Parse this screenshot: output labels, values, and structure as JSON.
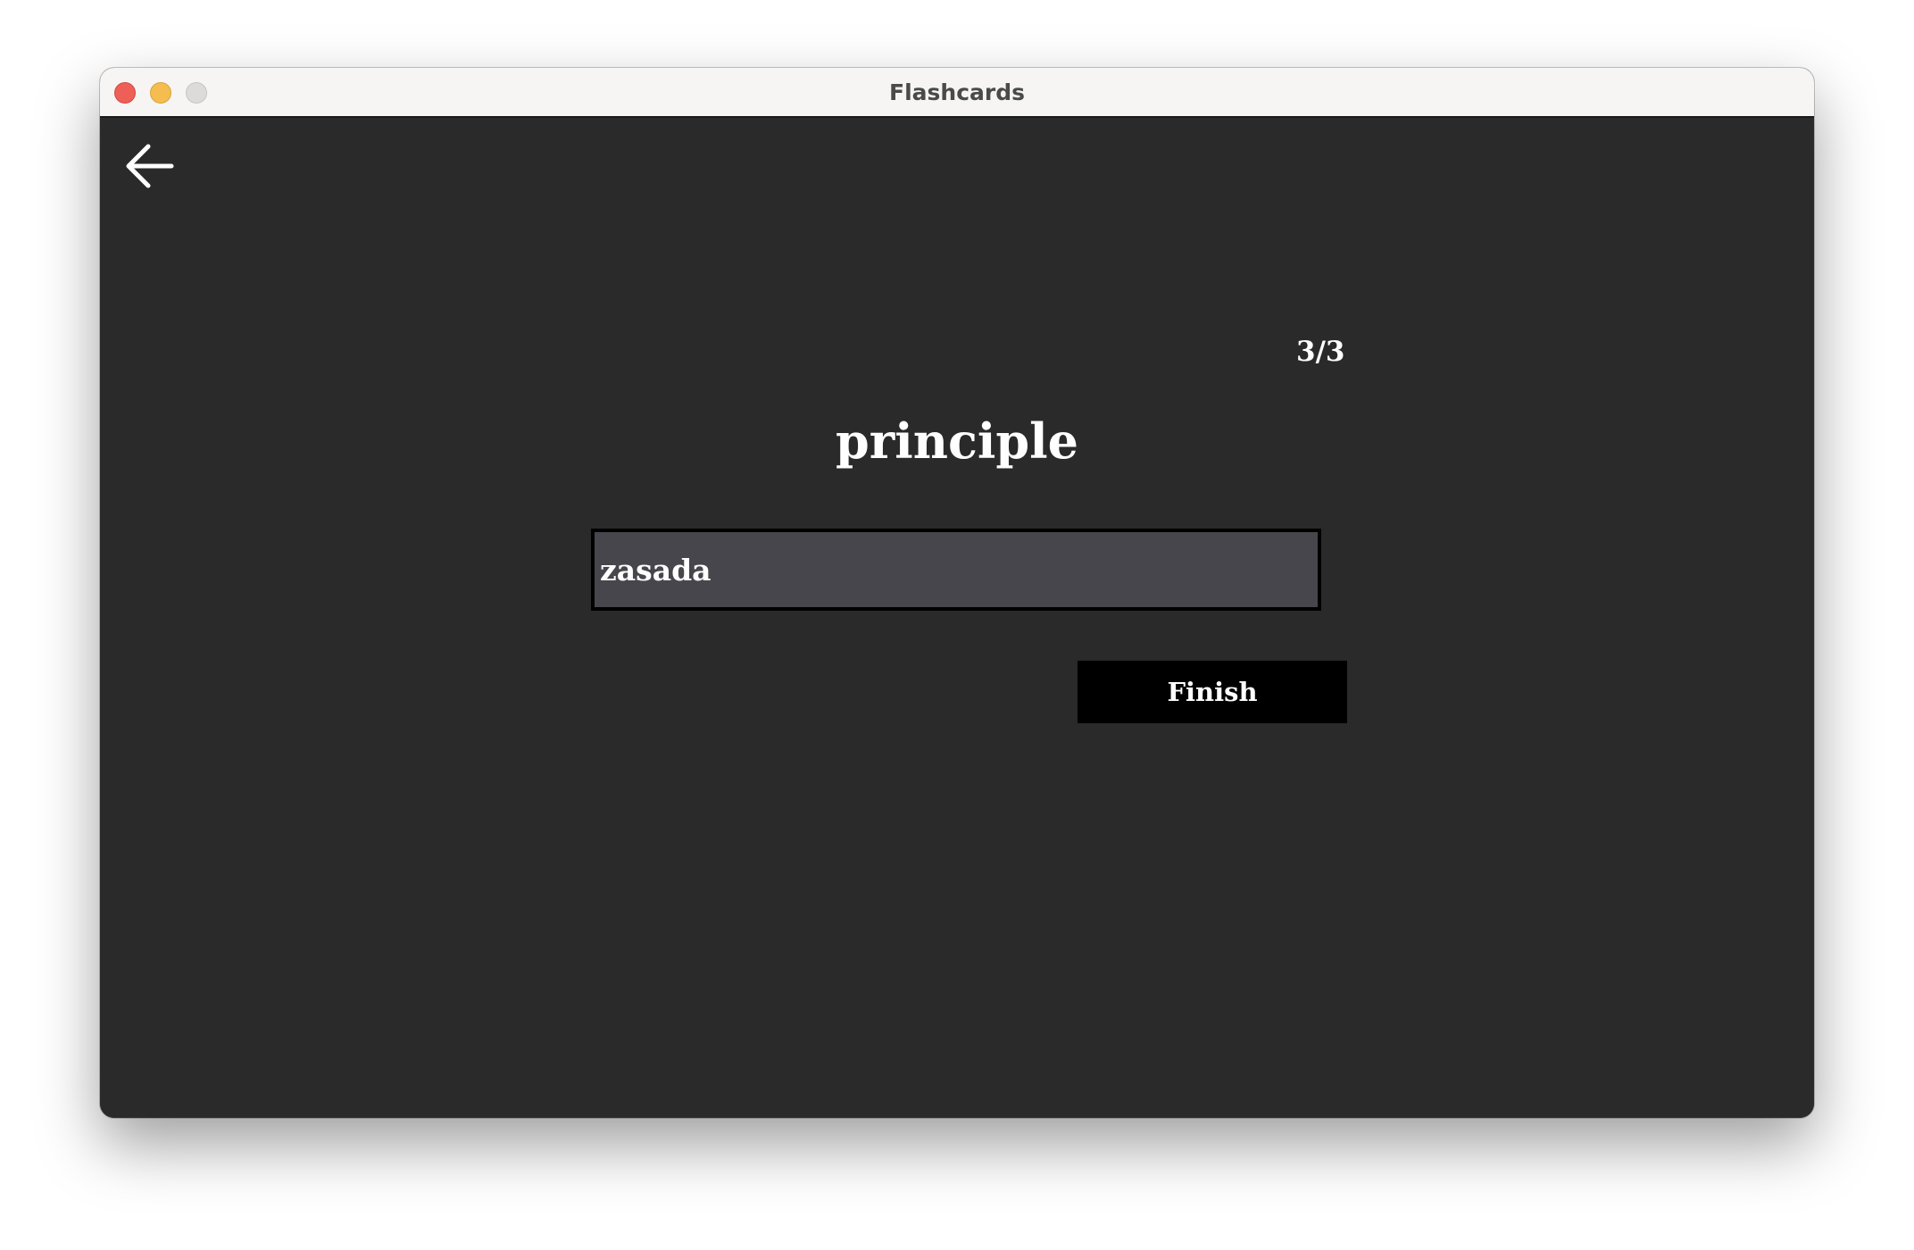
{
  "window": {
    "title": "Flashcards"
  },
  "toolbar": {
    "back_icon": "arrow-left-icon"
  },
  "card": {
    "counter": "3/3",
    "word": "principle",
    "answer_value": "zasada",
    "finish_label": "Finish"
  },
  "colors": {
    "background": "#2a2a2a",
    "input_background": "#46464c",
    "button_background": "#000000",
    "text": "#ffffff"
  }
}
